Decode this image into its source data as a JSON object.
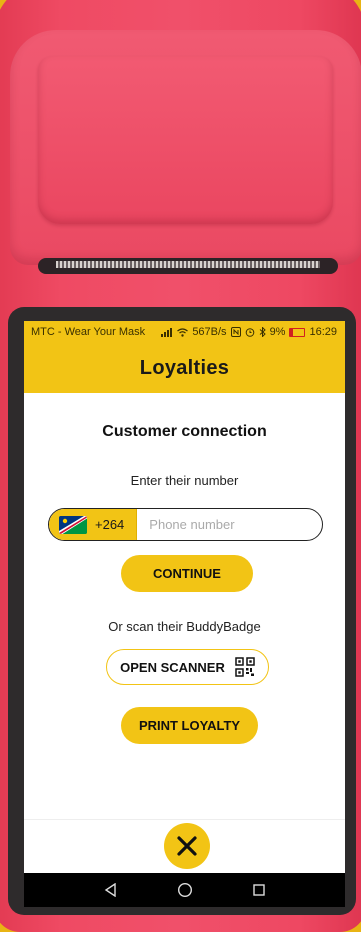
{
  "status_bar": {
    "carrier": "MTC - Wear Your Mask",
    "network_speed": "567B/s",
    "battery": "9%",
    "time": "16:29",
    "icons": [
      "signal-icon",
      "wifi-icon",
      "nfc-icon",
      "alarm-icon",
      "bluetooth-icon",
      "battery-icon"
    ]
  },
  "header": {
    "title": "Loyalties"
  },
  "main": {
    "section_title": "Customer connection",
    "enter_label": "Enter their number",
    "phone": {
      "country_code": "+264",
      "placeholder": "Phone number",
      "value": "",
      "flag": "namibia-flag"
    },
    "continue_label": "CONTINUE",
    "scan_label": "Or scan their BuddyBadge",
    "open_scanner_label": "OPEN SCANNER",
    "print_loyalty_label": "PRINT LOYALTY"
  },
  "footer": {
    "close_icon": "close-icon"
  },
  "navbar": {
    "icons": [
      "back-icon",
      "home-icon",
      "recents-icon"
    ]
  },
  "colors": {
    "accent": "#f2c415",
    "device": "#ee4862"
  }
}
